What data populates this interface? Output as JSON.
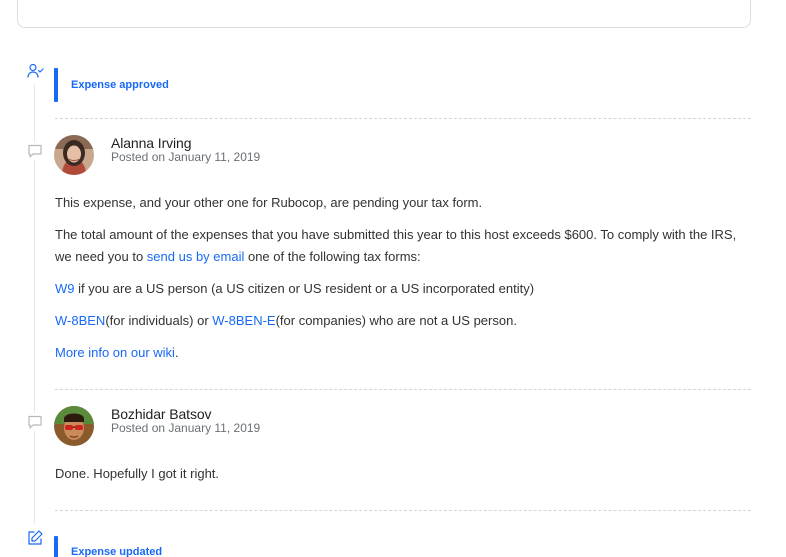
{
  "activities": {
    "approved_label": "Expense approved",
    "updated_label": "Expense updated"
  },
  "comments": [
    {
      "author": "Alanna Irving",
      "posted": "Posted on January 11, 2019",
      "paragraphs": {
        "p1": "This expense, and your other one for Rubocop, are pending your tax form.",
        "p2_before": "The total amount of the expenses that you have submitted this year to this host exceeds $600. To comply with the IRS, we need you to ",
        "p2_link": "send us by email",
        "p2_after": " one of the following tax forms:",
        "p3_link": "W9",
        "p3_after": " if you are a US person (a US citizen or US resident or a US incorporated entity)",
        "p4_link1": "W-8BEN",
        "p4_mid": "(for individuals) or ",
        "p4_link2": "W-8BEN-E",
        "p4_after": "(for companies) who are not a US person.",
        "p5_link": "More info on our wiki",
        "p5_after": "."
      }
    },
    {
      "author": "Bozhidar Batsov",
      "posted": "Posted on January 11, 2019",
      "text": "Done. Hopefully I got it right."
    }
  ],
  "colors": {
    "accent": "#1869f5",
    "text": "#313233",
    "muted": "#6b7075",
    "divider": "#d3d5d9"
  },
  "icons": {
    "approved": "user-check-icon",
    "comment": "comment-icon",
    "updated": "edit-icon"
  }
}
